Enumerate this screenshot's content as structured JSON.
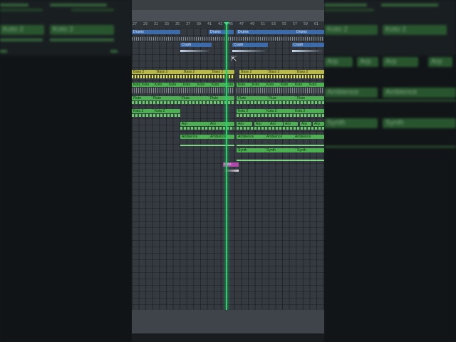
{
  "ruler": {
    "bars": [
      "27",
      "29",
      "31",
      "33",
      "35",
      "37",
      "39",
      "41",
      "43",
      "45",
      "47",
      "49",
      "51",
      "53",
      "55",
      "57",
      "59",
      "61"
    ]
  },
  "clips": {
    "drums": "Drums",
    "crash": "Crash",
    "bass2": "Bass 2",
    "koto": "Koto",
    "koto2": "Koto 2",
    "flute": "Flute",
    "arp": "Arp",
    "ambience": "Ambience",
    "synth": "Synth",
    "rev": "Rev.."
  },
  "background_labels": {
    "koto2": "Koto 2",
    "arp": "Arp",
    "ambience": "Ambience",
    "synth": "Synth"
  },
  "colors": {
    "drums_clip": "#3d6aa8",
    "bass_clip": "#b8b94a",
    "melody_clip": "#4cb052",
    "fx_clip": "#b04aa8",
    "playhead": "#2bd06b"
  }
}
